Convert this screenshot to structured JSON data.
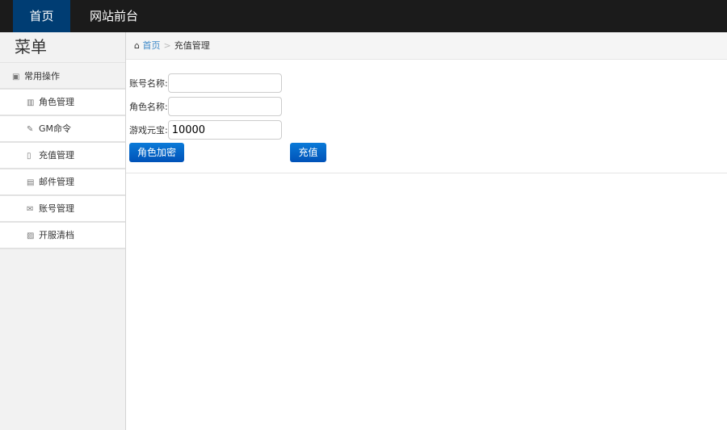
{
  "topnav": [
    "首页",
    "网站前台"
  ],
  "sidebar": {
    "title": "菜单",
    "group": "常用操作",
    "items": [
      {
        "label": "角色管理",
        "icon": "books-icon"
      },
      {
        "label": "GM命令",
        "icon": "plug-icon"
      },
      {
        "label": "充值管理",
        "icon": "file-icon"
      },
      {
        "label": "邮件管理",
        "icon": "list-icon"
      },
      {
        "label": "账号管理",
        "icon": "envelope-icon"
      },
      {
        "label": "开服清档",
        "icon": "picture-icon"
      }
    ]
  },
  "breadcrumb": {
    "home": "首页",
    "sep": ">",
    "current": "充值管理"
  },
  "form": {
    "account_label": "账号名称:",
    "account_value": "",
    "role_label": "角色名称:",
    "role_value": "",
    "gold_label": "游戏元宝:",
    "gold_value": "10000",
    "encrypt_button": "角色加密",
    "recharge_button": "充值"
  }
}
